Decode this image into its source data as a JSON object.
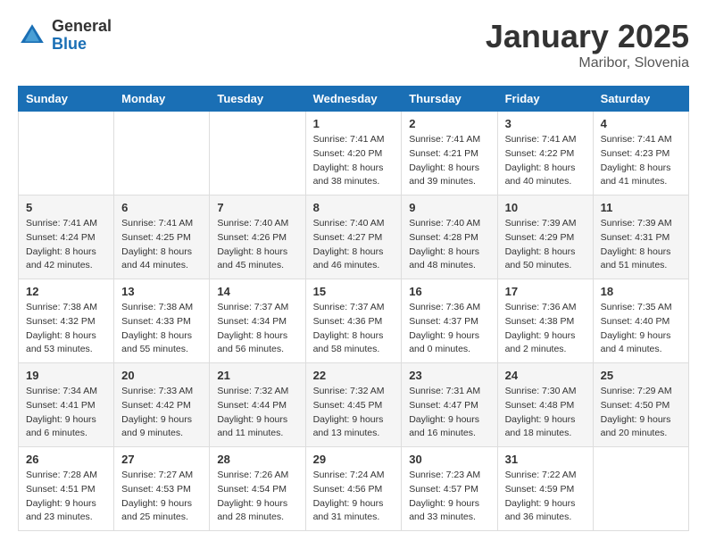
{
  "logo": {
    "general": "General",
    "blue": "Blue"
  },
  "title": "January 2025",
  "location": "Maribor, Slovenia",
  "weekdays": [
    "Sunday",
    "Monday",
    "Tuesday",
    "Wednesday",
    "Thursday",
    "Friday",
    "Saturday"
  ],
  "weeks": [
    [
      {
        "day": "",
        "sunrise": "",
        "sunset": "",
        "daylight": ""
      },
      {
        "day": "",
        "sunrise": "",
        "sunset": "",
        "daylight": ""
      },
      {
        "day": "",
        "sunrise": "",
        "sunset": "",
        "daylight": ""
      },
      {
        "day": "1",
        "sunrise": "Sunrise: 7:41 AM",
        "sunset": "Sunset: 4:20 PM",
        "daylight": "Daylight: 8 hours and 38 minutes."
      },
      {
        "day": "2",
        "sunrise": "Sunrise: 7:41 AM",
        "sunset": "Sunset: 4:21 PM",
        "daylight": "Daylight: 8 hours and 39 minutes."
      },
      {
        "day": "3",
        "sunrise": "Sunrise: 7:41 AM",
        "sunset": "Sunset: 4:22 PM",
        "daylight": "Daylight: 8 hours and 40 minutes."
      },
      {
        "day": "4",
        "sunrise": "Sunrise: 7:41 AM",
        "sunset": "Sunset: 4:23 PM",
        "daylight": "Daylight: 8 hours and 41 minutes."
      }
    ],
    [
      {
        "day": "5",
        "sunrise": "Sunrise: 7:41 AM",
        "sunset": "Sunset: 4:24 PM",
        "daylight": "Daylight: 8 hours and 42 minutes."
      },
      {
        "day": "6",
        "sunrise": "Sunrise: 7:41 AM",
        "sunset": "Sunset: 4:25 PM",
        "daylight": "Daylight: 8 hours and 44 minutes."
      },
      {
        "day": "7",
        "sunrise": "Sunrise: 7:40 AM",
        "sunset": "Sunset: 4:26 PM",
        "daylight": "Daylight: 8 hours and 45 minutes."
      },
      {
        "day": "8",
        "sunrise": "Sunrise: 7:40 AM",
        "sunset": "Sunset: 4:27 PM",
        "daylight": "Daylight: 8 hours and 46 minutes."
      },
      {
        "day": "9",
        "sunrise": "Sunrise: 7:40 AM",
        "sunset": "Sunset: 4:28 PM",
        "daylight": "Daylight: 8 hours and 48 minutes."
      },
      {
        "day": "10",
        "sunrise": "Sunrise: 7:39 AM",
        "sunset": "Sunset: 4:29 PM",
        "daylight": "Daylight: 8 hours and 50 minutes."
      },
      {
        "day": "11",
        "sunrise": "Sunrise: 7:39 AM",
        "sunset": "Sunset: 4:31 PM",
        "daylight": "Daylight: 8 hours and 51 minutes."
      }
    ],
    [
      {
        "day": "12",
        "sunrise": "Sunrise: 7:38 AM",
        "sunset": "Sunset: 4:32 PM",
        "daylight": "Daylight: 8 hours and 53 minutes."
      },
      {
        "day": "13",
        "sunrise": "Sunrise: 7:38 AM",
        "sunset": "Sunset: 4:33 PM",
        "daylight": "Daylight: 8 hours and 55 minutes."
      },
      {
        "day": "14",
        "sunrise": "Sunrise: 7:37 AM",
        "sunset": "Sunset: 4:34 PM",
        "daylight": "Daylight: 8 hours and 56 minutes."
      },
      {
        "day": "15",
        "sunrise": "Sunrise: 7:37 AM",
        "sunset": "Sunset: 4:36 PM",
        "daylight": "Daylight: 8 hours and 58 minutes."
      },
      {
        "day": "16",
        "sunrise": "Sunrise: 7:36 AM",
        "sunset": "Sunset: 4:37 PM",
        "daylight": "Daylight: 9 hours and 0 minutes."
      },
      {
        "day": "17",
        "sunrise": "Sunrise: 7:36 AM",
        "sunset": "Sunset: 4:38 PM",
        "daylight": "Daylight: 9 hours and 2 minutes."
      },
      {
        "day": "18",
        "sunrise": "Sunrise: 7:35 AM",
        "sunset": "Sunset: 4:40 PM",
        "daylight": "Daylight: 9 hours and 4 minutes."
      }
    ],
    [
      {
        "day": "19",
        "sunrise": "Sunrise: 7:34 AM",
        "sunset": "Sunset: 4:41 PM",
        "daylight": "Daylight: 9 hours and 6 minutes."
      },
      {
        "day": "20",
        "sunrise": "Sunrise: 7:33 AM",
        "sunset": "Sunset: 4:42 PM",
        "daylight": "Daylight: 9 hours and 9 minutes."
      },
      {
        "day": "21",
        "sunrise": "Sunrise: 7:32 AM",
        "sunset": "Sunset: 4:44 PM",
        "daylight": "Daylight: 9 hours and 11 minutes."
      },
      {
        "day": "22",
        "sunrise": "Sunrise: 7:32 AM",
        "sunset": "Sunset: 4:45 PM",
        "daylight": "Daylight: 9 hours and 13 minutes."
      },
      {
        "day": "23",
        "sunrise": "Sunrise: 7:31 AM",
        "sunset": "Sunset: 4:47 PM",
        "daylight": "Daylight: 9 hours and 16 minutes."
      },
      {
        "day": "24",
        "sunrise": "Sunrise: 7:30 AM",
        "sunset": "Sunset: 4:48 PM",
        "daylight": "Daylight: 9 hours and 18 minutes."
      },
      {
        "day": "25",
        "sunrise": "Sunrise: 7:29 AM",
        "sunset": "Sunset: 4:50 PM",
        "daylight": "Daylight: 9 hours and 20 minutes."
      }
    ],
    [
      {
        "day": "26",
        "sunrise": "Sunrise: 7:28 AM",
        "sunset": "Sunset: 4:51 PM",
        "daylight": "Daylight: 9 hours and 23 minutes."
      },
      {
        "day": "27",
        "sunrise": "Sunrise: 7:27 AM",
        "sunset": "Sunset: 4:53 PM",
        "daylight": "Daylight: 9 hours and 25 minutes."
      },
      {
        "day": "28",
        "sunrise": "Sunrise: 7:26 AM",
        "sunset": "Sunset: 4:54 PM",
        "daylight": "Daylight: 9 hours and 28 minutes."
      },
      {
        "day": "29",
        "sunrise": "Sunrise: 7:24 AM",
        "sunset": "Sunset: 4:56 PM",
        "daylight": "Daylight: 9 hours and 31 minutes."
      },
      {
        "day": "30",
        "sunrise": "Sunrise: 7:23 AM",
        "sunset": "Sunset: 4:57 PM",
        "daylight": "Daylight: 9 hours and 33 minutes."
      },
      {
        "day": "31",
        "sunrise": "Sunrise: 7:22 AM",
        "sunset": "Sunset: 4:59 PM",
        "daylight": "Daylight: 9 hours and 36 minutes."
      },
      {
        "day": "",
        "sunrise": "",
        "sunset": "",
        "daylight": ""
      }
    ]
  ]
}
